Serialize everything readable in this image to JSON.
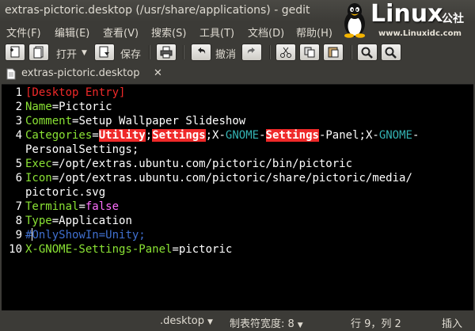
{
  "window": {
    "title": "extras-pictoric.desktop (/usr/share/applications) - gedit"
  },
  "logo": {
    "brand": "Linux",
    "suffix": "公社",
    "url": "www.Linuxidc.com"
  },
  "menu": [
    {
      "label": "文件(F)"
    },
    {
      "label": "编辑(E)"
    },
    {
      "label": "查看(V)"
    },
    {
      "label": "搜索(S)"
    },
    {
      "label": "工具(T)"
    },
    {
      "label": "文档(D)"
    },
    {
      "label": "帮助(H)"
    }
  ],
  "toolbar": {
    "open_label": "打开",
    "save_label": "保存",
    "undo_label": "撤消"
  },
  "tab": {
    "name": "extras-pictoric.desktop",
    "close": "✕"
  },
  "editor": {
    "line_numbers": [
      "1",
      "2",
      "3",
      "4",
      "",
      "5",
      "6",
      "",
      "7",
      "8",
      "9",
      "10"
    ]
  },
  "code": {
    "l1": "[Desktop Entry]",
    "l2k": "Name",
    "l2v": "Pictoric",
    "l3k": "Comment",
    "l3v": "Setup Wallpaper Slideshow",
    "l4k": "Categories",
    "l4a": "Utility",
    "l4b": "Settings",
    "l4c": ";X-",
    "l4d": "GNOME",
    "l4e": "-",
    "l4f": "Settings",
    "l4g": "-Panel;X-",
    "l4h": "GNOME",
    "l4i": "-",
    "l4cont": "PersonalSettings;",
    "l5k": "Exec",
    "l5v": "/opt/extras.ubuntu.com/pictoric/bin/pictoric",
    "l6k": "Icon",
    "l6v": "/opt/extras.ubuntu.com/pictoric/share/pictoric/media/",
    "l6cont": "pictoric.svg",
    "l7k": "Terminal",
    "l7v": "false",
    "l8k": "Type",
    "l8v": "Application",
    "l9a": "#",
    "l9b": "OnlyShowIn=Unity;",
    "l10k": "X-GNOME-Settings-Panel",
    "l10v": "pictoric"
  },
  "status": {
    "filetype": ".desktop",
    "tabwidth": "制表符宽度: 8",
    "position": "行 9，列 2",
    "mode": "插入"
  }
}
